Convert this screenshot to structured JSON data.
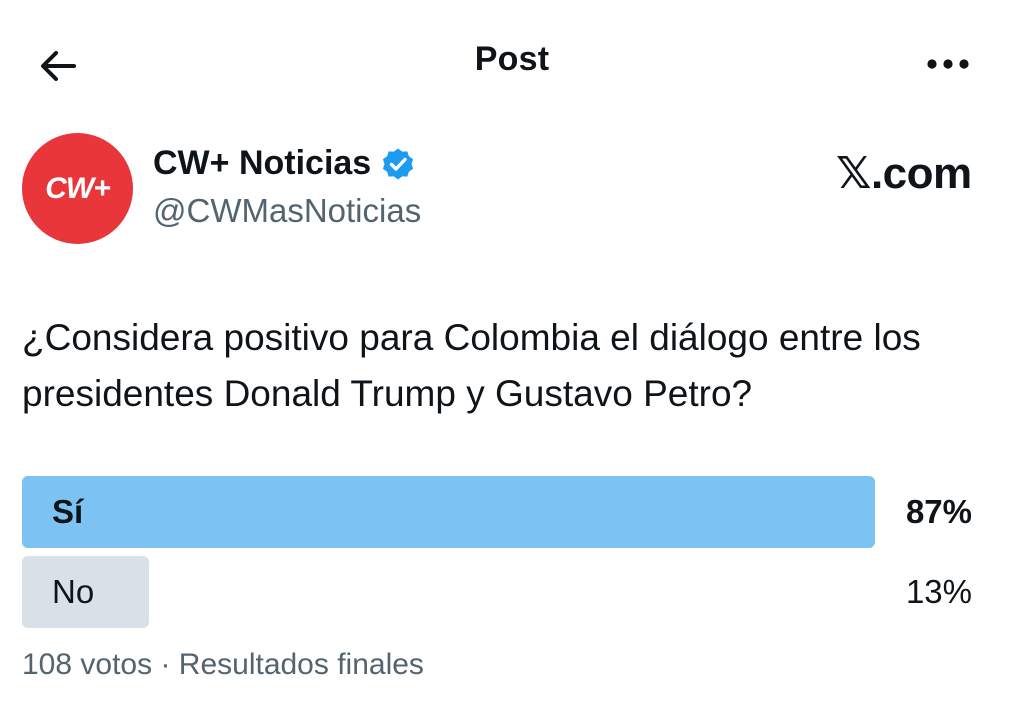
{
  "header": {
    "title": "Post",
    "back_icon": "arrow-left-icon",
    "more_icon": "more-horizontal-icon"
  },
  "author": {
    "avatar_text": "CW+",
    "display_name": "CW+ Noticias",
    "handle": "@CWMasNoticias",
    "verified_icon": "verified-badge-icon",
    "avatar_color": "#e8363b",
    "verified_color": "#1d9bf0"
  },
  "watermark": "𝕏.com",
  "post": {
    "text": "¿Considera positivo para Colombia el diálogo entre los presidentes Donald Trump y Gustavo Petro?"
  },
  "poll": {
    "options": [
      {
        "label": "Sí",
        "percent_text": "87%",
        "fraction": 0.87,
        "winner": true,
        "bar_color": "#7cc3f4"
      },
      {
        "label": "No",
        "percent_text": "13%",
        "fraction": 0.13,
        "winner": false,
        "bar_color": "#d9e1e8"
      }
    ],
    "votes": "108 votos",
    "separator": "·",
    "status": "Resultados finales"
  }
}
